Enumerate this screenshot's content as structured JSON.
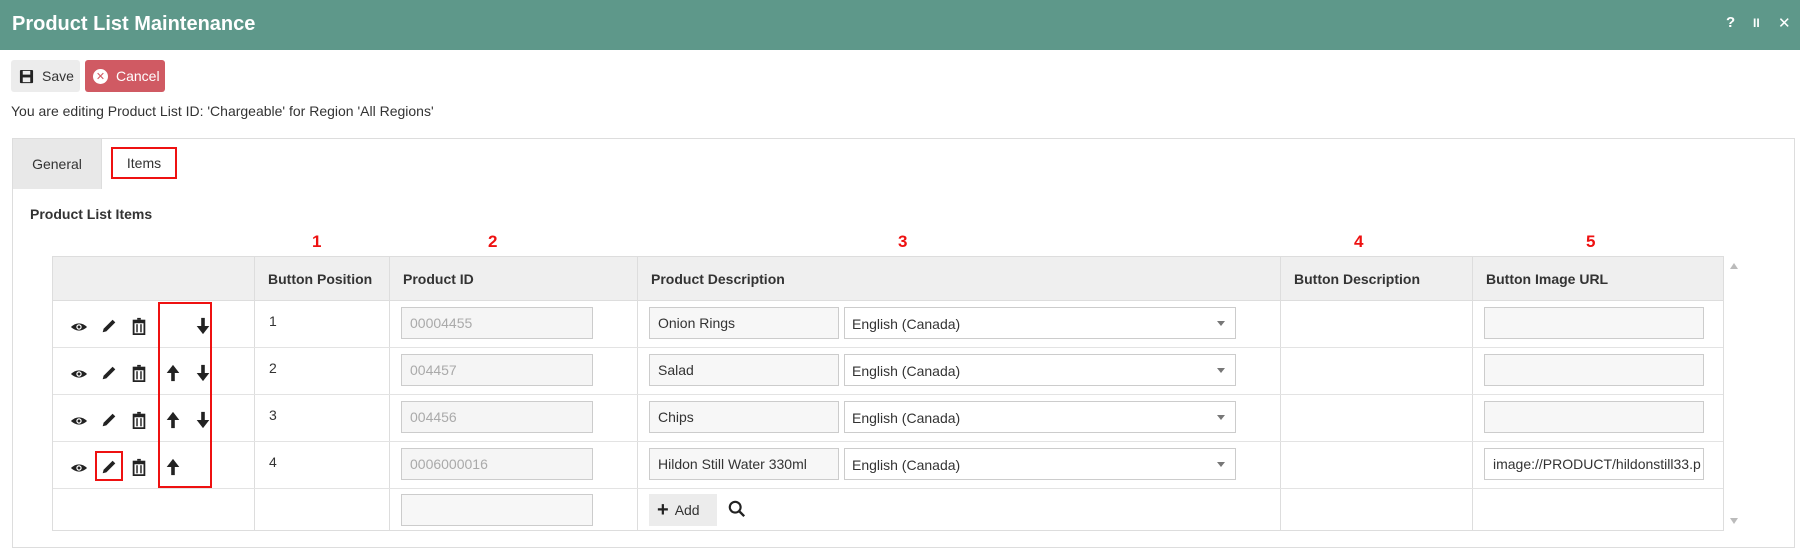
{
  "window": {
    "title": "Product List Maintenance",
    "help": "?",
    "pause": "II",
    "close": "✕"
  },
  "toolbar": {
    "save_label": "Save",
    "cancel_label": "Cancel"
  },
  "edit_info": "You are editing Product List ID: 'Chargeable' for Region 'All Regions'",
  "tabs": [
    {
      "label": "General"
    },
    {
      "label": "Items"
    }
  ],
  "section_title": "Product List Items",
  "column_numbers": [
    "1",
    "2",
    "3",
    "4",
    "5"
  ],
  "columns": {
    "button_position": "Button Position",
    "product_id": "Product ID",
    "product_description": "Product Description",
    "button_description": "Button Description",
    "button_image_url": "Button Image URL"
  },
  "rows": [
    {
      "position": "1",
      "product_id": "00004455",
      "description": "Onion Rings",
      "language": "English (Canada)",
      "button_description": "",
      "image_url": ""
    },
    {
      "position": "2",
      "product_id": "004457",
      "description": "Salad",
      "language": "English (Canada)",
      "button_description": "",
      "image_url": ""
    },
    {
      "position": "3",
      "product_id": "004456",
      "description": "Chips",
      "language": "English (Canada)",
      "button_description": "",
      "image_url": ""
    },
    {
      "position": "4",
      "product_id": "0006000016",
      "description": "Hildon Still Water 330ml",
      "language": "English (Canada)",
      "button_description": "",
      "image_url": "image://PRODUCT/hildonstill33.p"
    }
  ],
  "new_row": {
    "product_id": "",
    "add_label": "Add"
  },
  "icons": [
    "eye-icon",
    "pencil-icon",
    "trash-icon",
    "arrow-up-icon",
    "arrow-down-icon",
    "save-icon",
    "cancel-icon",
    "plus-icon",
    "search-icon"
  ],
  "colors": {
    "titlebar": "#5e988a",
    "cancel": "#d05a63",
    "highlight": "#ee1111"
  }
}
